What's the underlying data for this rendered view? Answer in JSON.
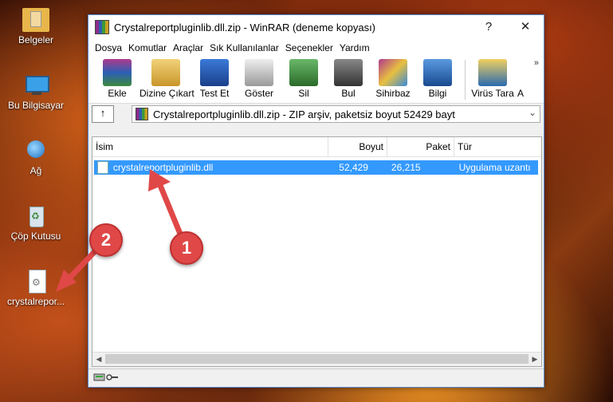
{
  "desktop": {
    "icons": [
      {
        "label": "Belgeler",
        "icon": "folder-icon"
      },
      {
        "label": "Bu Bilgisayar",
        "icon": "computer-icon"
      },
      {
        "label": "Ağ",
        "icon": "network-icon"
      },
      {
        "label": "Çöp Kutusu",
        "icon": "recycle-bin-icon"
      },
      {
        "label": "crystalrepor...",
        "icon": "dll-file-icon"
      }
    ]
  },
  "window": {
    "title": "Crystalreportpluginlib.dll.zip - WinRAR (deneme kopyası)",
    "help_label": "?",
    "close_label": "✕",
    "menu": [
      "Dosya",
      "Komutlar",
      "Araçlar",
      "Sık Kullanılanlar",
      "Seçenekler",
      "Yardım"
    ],
    "toolbar": [
      {
        "label": "Ekle",
        "icon": "add-icon",
        "color": "#b03a8c"
      },
      {
        "label": "Dizine Çıkart",
        "icon": "extract-folder-icon",
        "color": "#d6b04a"
      },
      {
        "label": "Test Et",
        "icon": "test-icon",
        "color": "#2b5fb5"
      },
      {
        "label": "Göster",
        "icon": "view-icon",
        "color": "#888888"
      },
      {
        "label": "Sil",
        "icon": "delete-icon",
        "color": "#3c8a3c"
      },
      {
        "label": "Bul",
        "icon": "find-icon",
        "color": "#555555"
      },
      {
        "label": "Sihirbaz",
        "icon": "wizard-icon",
        "color": "#9a3aa8"
      },
      {
        "label": "Bilgi",
        "icon": "info-icon",
        "color": "#2a6ab0"
      },
      {
        "label": "Virüs Tara",
        "icon": "virus-scan-icon",
        "color": "#c8a020"
      }
    ],
    "toolbar_more": "»",
    "toolbar_trunc": "A",
    "up_icon": "↑",
    "address": "Crystalreportpluginlib.dll.zip - ZIP arşiv, paketsiz boyut 52429 bayt",
    "address_dropdown": "⌄",
    "columns": [
      "İsim",
      "Boyut",
      "Paket",
      "Tür"
    ],
    "files": [
      {
        "name": "crystalreportpluginlib.dll",
        "size": "52,429",
        "packed": "26,215",
        "type": "Uygulama uzantı"
      }
    ],
    "scroll_left": "◀",
    "scroll_right": "▶"
  },
  "callouts": [
    "1",
    "2"
  ],
  "colors": {
    "selection": "#3399ff",
    "callout": "#e04848"
  }
}
